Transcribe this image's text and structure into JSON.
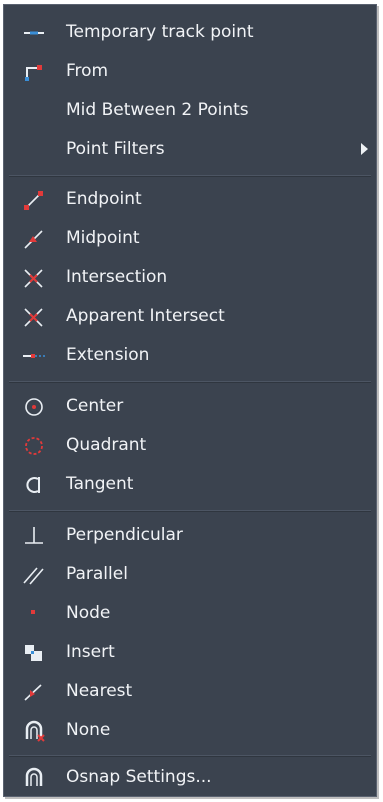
{
  "menu": {
    "items": [
      {
        "label": "Temporary track point",
        "icon": "temporary-track-point-icon",
        "submenu": false
      },
      {
        "label": "From",
        "icon": "from-icon",
        "submenu": false
      },
      {
        "label": "Mid Between 2 Points",
        "icon": "",
        "submenu": false
      },
      {
        "label": "Point Filters",
        "icon": "",
        "submenu": true
      },
      {
        "label": "Endpoint",
        "icon": "endpoint-icon",
        "submenu": false
      },
      {
        "label": "Midpoint",
        "icon": "midpoint-icon",
        "submenu": false
      },
      {
        "label": "Intersection",
        "icon": "intersection-icon",
        "submenu": false
      },
      {
        "label": "Apparent Intersect",
        "icon": "apparent-intersect-icon",
        "submenu": false
      },
      {
        "label": "Extension",
        "icon": "extension-icon",
        "submenu": false
      },
      {
        "label": "Center",
        "icon": "center-icon",
        "submenu": false
      },
      {
        "label": "Quadrant",
        "icon": "quadrant-icon",
        "submenu": false
      },
      {
        "label": "Tangent",
        "icon": "tangent-icon",
        "submenu": false
      },
      {
        "label": "Perpendicular",
        "icon": "perpendicular-icon",
        "submenu": false
      },
      {
        "label": "Parallel",
        "icon": "parallel-icon",
        "submenu": false
      },
      {
        "label": "Node",
        "icon": "node-icon",
        "submenu": false
      },
      {
        "label": "Insert",
        "icon": "insert-icon",
        "submenu": false
      },
      {
        "label": "Nearest",
        "icon": "nearest-icon",
        "submenu": false
      },
      {
        "label": "None",
        "icon": "none-icon",
        "submenu": false
      },
      {
        "label": "Osnap Settings...",
        "icon": "osnap-settings-icon",
        "submenu": false
      }
    ]
  },
  "colors": {
    "background": "#3b434f",
    "text": "#f1f3f6",
    "accent_red": "#e23a3a",
    "accent_blue": "#3a8fd8"
  }
}
